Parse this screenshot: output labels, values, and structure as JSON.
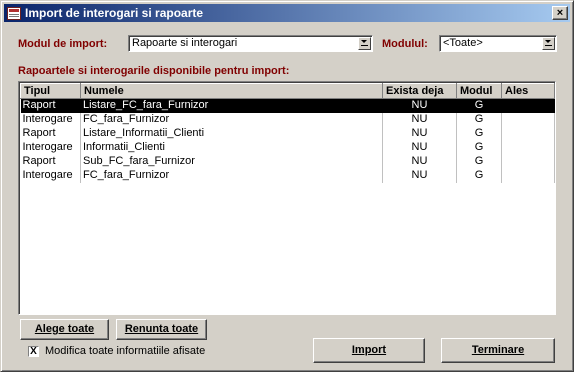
{
  "window": {
    "title": "Import de interogari si rapoarte",
    "close_glyph": "×"
  },
  "filters": {
    "mode_label": "Modul de import:",
    "mode_value": "Rapoarte si interogari",
    "module_label": "Modulul:",
    "module_value": "<Toate>"
  },
  "list": {
    "caption": "Rapoartele si interogarile disponibile pentru import:",
    "columns": [
      "Tipul",
      "Numele",
      "Exista deja",
      "Modul",
      "Ales"
    ],
    "rows": [
      {
        "tipul": "Raport",
        "numele": "Listare_FC_fara_Furnizor",
        "exista": "NU",
        "modul": "G",
        "ales": "",
        "selected": true
      },
      {
        "tipul": "Interogare",
        "numele": "FC_fara_Furnizor",
        "exista": "NU",
        "modul": "G",
        "ales": "",
        "selected": false
      },
      {
        "tipul": "Raport",
        "numele": "Listare_Informatii_Clienti",
        "exista": "NU",
        "modul": "G",
        "ales": "",
        "selected": false
      },
      {
        "tipul": "Interogare",
        "numele": "Informatii_Clienti",
        "exista": "NU",
        "modul": "G",
        "ales": "",
        "selected": false
      },
      {
        "tipul": "Raport",
        "numele": "Sub_FC_fara_Furnizor",
        "exista": "NU",
        "modul": "G",
        "ales": "",
        "selected": false
      },
      {
        "tipul": "Interogare",
        "numele": "FC_fara_Furnizor",
        "exista": "NU",
        "modul": "G",
        "ales": "",
        "selected": false
      }
    ]
  },
  "buttons": {
    "select_all": "Alege toate",
    "deselect_all": "Renunta toate",
    "import": "Import",
    "finish": "Terminare"
  },
  "options": {
    "modify_all_label": "Modifica toate informatiile afisate",
    "modify_all_checked": true,
    "check_glyph": "X"
  }
}
